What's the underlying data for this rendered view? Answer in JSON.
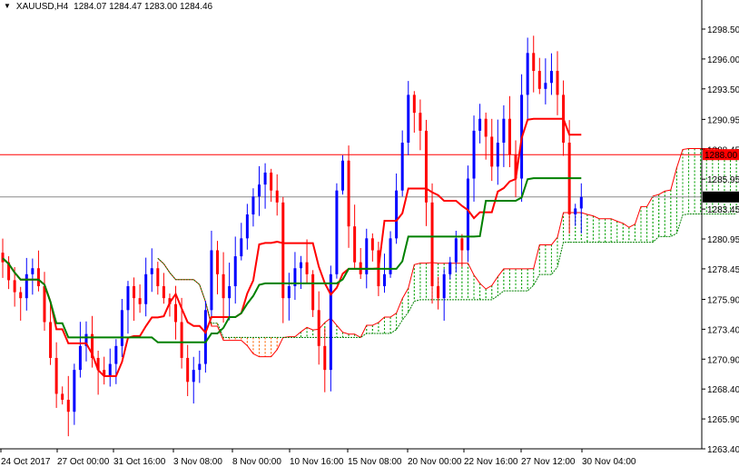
{
  "header": {
    "arrow": "▼",
    "symbol": "XAUUSD,H4",
    "ohlc": "1284.07 1284.47 1283.00 1284.46"
  },
  "chart_data": {
    "type": "candlestick",
    "title": "XAUUSD,H4",
    "ylim": [
      1263.4,
      1298.5
    ],
    "y_ticks": [
      "1298.50",
      "1296.00",
      "1293.50",
      "1290.95",
      "1288.45",
      "1285.95",
      "1283.45",
      "1280.95",
      "1278.45",
      "1275.90",
      "1273.40",
      "1270.90",
      "1268.40",
      "1265.90",
      "1263.40"
    ],
    "x_ticks": [
      "24 Oct 2017",
      "27 Oct 00:00",
      "31 Oct 16:00",
      "3 Nov 08:00",
      "8 Nov 00:00",
      "10 Nov 16:00",
      "15 Nov 08:00",
      "20 Nov 00:00",
      "22 Nov 16:00",
      "27 Nov 12:00",
      "30 Nov 04:00"
    ],
    "closes": [
      1279,
      1277.5,
      1276.5,
      1276,
      1278,
      1278.5,
      1277,
      1274,
      1271,
      1268,
      1267.5,
      1266.5,
      1270,
      1272,
      1273,
      1271,
      1270,
      1269.5,
      1270.5,
      1272,
      1275,
      1277,
      1276,
      1275.5,
      1278,
      1278.5,
      1277,
      1276,
      1275.5,
      1274,
      1271,
      1269,
      1270,
      1270.5,
      1275,
      1280,
      1278,
      1276,
      1277,
      1279.5,
      1281,
      1283,
      1284.5,
      1285.5,
      1286.5,
      1285,
      1284,
      1276,
      1277,
      1278.5,
      1279,
      1278,
      1275,
      1272,
      1270,
      1278,
      1285,
      1287.5,
      1282,
      1279,
      1278,
      1281,
      1280,
      1277,
      1278,
      1281,
      1285,
      1289,
      1293,
      1291.5,
      1290,
      1284,
      1277,
      1276,
      1278,
      1279,
      1281,
      1280,
      1286,
      1290,
      1291,
      1289.5,
      1287,
      1289,
      1291,
      1288,
      1286,
      1293,
      1296.5,
      1295,
      1293.5,
      1294,
      1295,
      1293,
      1289,
      1283,
      1283.5,
      1284.46
    ],
    "lines": [
      {
        "name": "resistance",
        "value": 1288.0,
        "label": "1288.00",
        "color": "#ff0000"
      },
      {
        "name": "current-price",
        "value": 1284.46,
        "label": "1284.46",
        "color": "#000000"
      }
    ],
    "colors": {
      "bull": "#0000ff",
      "bear": "#ff0000",
      "tenkan": "#ff0000",
      "kijun": "#008000",
      "cloud_up": "#00a000",
      "cloud_down": "#ff6600"
    }
  }
}
